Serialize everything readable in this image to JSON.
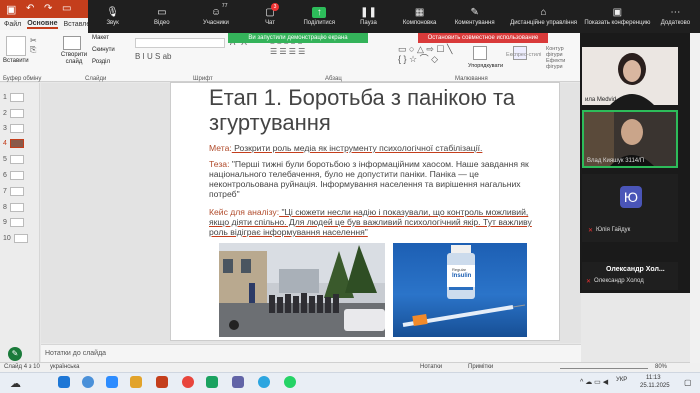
{
  "ribbon": {
    "tabs": [
      "Файл",
      "Основне",
      "Вставлення"
    ],
    "active_tab": "Основне",
    "groups": [
      "Буфер обміну",
      "Слайди",
      "Шрифт",
      "Абзац",
      "Малювання"
    ],
    "paste_label": "Вставити",
    "new_slide_label": "Створити слайд",
    "layout_label": "Макет",
    "reset_label": "Скинути",
    "section_label": "Розділ",
    "arrange_label": "Упорядкувати",
    "express_label": "Експрес-стилі",
    "outline_label": "Контур фігури",
    "effects_label": "Ефекти фігури"
  },
  "zoom": {
    "items": [
      {
        "label": "Звук",
        "icon": "mic-muted-icon"
      },
      {
        "label": "Відео",
        "icon": "camera-icon"
      },
      {
        "label": "Учасники",
        "icon": "participants-icon",
        "count": "77"
      },
      {
        "label": "Чат",
        "icon": "chat-icon",
        "badge": "3"
      },
      {
        "label": "Поділитися",
        "icon": "share-icon"
      },
      {
        "label": "Пауза",
        "icon": "pause-icon"
      },
      {
        "label": "Компоновка",
        "icon": "layout-icon"
      },
      {
        "label": "Коментування",
        "icon": "pen-icon"
      },
      {
        "label": "Дистанційне управління",
        "icon": "mouse-icon"
      },
      {
        "label": "Показать конференцию",
        "icon": "conference-icon"
      },
      {
        "label": "Додатково",
        "icon": "more-icon"
      }
    ],
    "share_notice": "Ви запустили демонстрацію екрана",
    "stop_share": "Остановить совместное использование"
  },
  "thumbs": [
    "1",
    "2",
    "3",
    "4",
    "5",
    "6",
    "7",
    "8",
    "9",
    "10"
  ],
  "selected_thumb": "4",
  "slide": {
    "title": "Етап 1. Боротьба з панікою та згуртування",
    "goal_label": "Мета:",
    "goal_text": " Розкрити роль медіа як інструменту психологічної стабілізації.",
    "thesis_label": "Теза:",
    "thesis_text": " \"Перші тижні були боротьбою з інформаційним хаосом. Наше завдання як національного телебачення, було не допустити паніки. Паніка — це неконтрольована руйнація. Інформування населення та вирішення нагальних потреб\"",
    "case_label": "Кейс для аналізу:",
    "case_text": " \"Ці сюжети несли надію і показували, що контроль можливий, якщо діяти спільно. Для людей це був важливий психологічний якір. Тут важливу роль відіграє інформування населення\"",
    "insulin_label1": "Regular",
    "insulin_label2": "Insulin"
  },
  "notes_placeholder": "Нотатки до слайда",
  "status": {
    "slide_of": "Слайд 4 з 10",
    "language": "українська",
    "notes": "Нотатки",
    "comments": "Примітки",
    "zoom_pct": "80%"
  },
  "participants": [
    {
      "name": "ила Medvid",
      "initial": ""
    },
    {
      "name": "Влад Кияшук 3114/П",
      "initial": ""
    },
    {
      "name": "Юлія Гайдук",
      "initial": "Ю"
    },
    {
      "name": "Олександр Хол...",
      "initial": ""
    },
    {
      "name": "Олександр Холод",
      "initial": ""
    }
  ],
  "taskbar": {
    "time": "11:13",
    "date": "25.11.2025",
    "lang": "УКР"
  },
  "colors": {
    "accent": "#c43e1c",
    "share_green": "#34b35a",
    "share_red": "#d93a3a",
    "zoom_bar": "#1f1f1f",
    "avatar_blue": "#4a55b8"
  }
}
